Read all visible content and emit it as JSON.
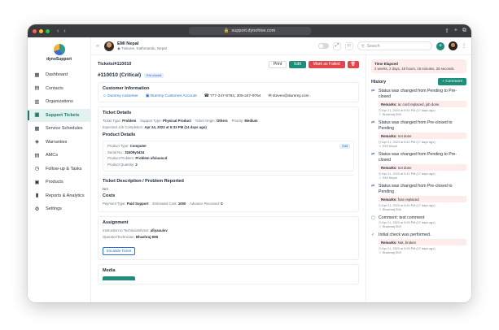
{
  "browser": {
    "url": "support.dynohive.com"
  },
  "brand": {
    "name": "dynoSupport"
  },
  "sidebar": {
    "items": [
      {
        "label": "Dashboard",
        "icon": "grid-icon"
      },
      {
        "label": "Contacts",
        "icon": "contacts-icon"
      },
      {
        "label": "Organizations",
        "icon": "building-icon"
      },
      {
        "label": "Support Tickets",
        "icon": "ticket-icon",
        "active": true
      },
      {
        "label": "Service Schedules",
        "icon": "calendar-icon"
      },
      {
        "label": "Warranties",
        "icon": "shield-icon"
      },
      {
        "label": "AMCs",
        "icon": "document-icon"
      },
      {
        "label": "Follow-up & Tasks",
        "icon": "clock-icon"
      },
      {
        "label": "Products",
        "icon": "box-icon"
      },
      {
        "label": "Reports & Analytics",
        "icon": "chart-icon"
      },
      {
        "label": "Settings",
        "icon": "gear-icon"
      }
    ]
  },
  "topbar": {
    "user_name": "EMI Nepal",
    "user_location": "Tinkune, Kathmandu, Nepal",
    "search_placeholder": "Search"
  },
  "ticket": {
    "breadcrumb": "Tickets/#110010",
    "title": "#110010 (Critical)",
    "priority_badge": "Pre-closed",
    "buttons": {
      "print": "Print",
      "edit": "Edit",
      "mark_failed": "Mark as Failed"
    },
    "customer": {
      "heading": "Customer Information",
      "name": "Dummy customer",
      "account": "Dummy Customer Account",
      "phone": "777-247-9764, 305-247-9764",
      "email": "steven@dummy.com"
    },
    "details": {
      "heading": "Ticket Details",
      "type_label": "Ticket Type:",
      "type": "Problem",
      "support_label": "Support Type:",
      "support": "Physical Product",
      "origin_label": "Ticket Origin:",
      "origin": "Others",
      "priority_label": "Priority:",
      "priority": "Medium",
      "completion_label": "Expected Job Completion:",
      "completion": "Apr 24, 2023 at 5:33 PM (14 days ago)"
    },
    "product": {
      "heading": "Product Details",
      "edit_chip": "Edit",
      "type_label": "Product Type:",
      "type": "Computer",
      "serial_label": "Serial No.:",
      "serial": "32409y0434",
      "problem_label": "Product Problem:",
      "problem": "Problem ufsiuuocd",
      "qty_label": "Product Quantity:",
      "qty": "2"
    },
    "description": {
      "heading": "Ticket Description / Problem Reported",
      "value": "N/A"
    },
    "costs": {
      "heading": "Costs",
      "payment_label": "Payment Type:",
      "payment": "Paid Support",
      "estimate_label": "Estimated Cost:",
      "estimate": "1000",
      "advance_label": "Advance Received:",
      "advance": "0"
    },
    "assignment": {
      "heading": "Assignment",
      "instruction_label": "Instruction to Technician/User:",
      "instruction": "afiyauuivv",
      "operator_label": "Operator/Technician:",
      "operator": "Bhashraj EMI",
      "escalate": "Escalate Ticket"
    },
    "media": {
      "heading": "Media"
    }
  },
  "history": {
    "elapsed_label": "Time Elapsed",
    "elapsed_value": "2 weeks, 2 days, 18 hours, 15 minutes, 26 seconds",
    "title": "History",
    "comment_button": "+ Comment",
    "entries": [
      {
        "text": "Status was changed from Pending to Pre-closed",
        "remarks_label": "Remarks:",
        "remarks": "ac cord replaced, job done",
        "date": "Apr 21, 2023 at 5:42 PM (17 days ago)",
        "by": "Bhashraj EMI"
      },
      {
        "text": "Status was changed from Pre-closed to Pending",
        "remarks_label": "Remarks:",
        "remarks": "not done",
        "date": "Apr 21, 2023 at 5:42 PM (17 days ago)",
        "by": "EMI Nepal"
      },
      {
        "text": "Status was changed from Pending to Pre-closed",
        "remarks_label": "Remarks:",
        "remarks": "not done",
        "date": "Apr 21, 2023 at 5:41 PM (17 days ago)",
        "by": "EMI Nepal"
      },
      {
        "text": "Status was changed from Pre-closed to Pending",
        "remarks_label": "Remarks:",
        "remarks": "fuse replaced",
        "date": "Apr 21, 2023 at 5:40 PM (17 days ago)",
        "by": "Bhashraj EMI"
      },
      {
        "text": "Comment: test comment",
        "date": "Apr 21, 2023 at 5:39 PM (17 days ago)",
        "by": "Bhashraj EMI"
      },
      {
        "text": "Initial check was performed.",
        "remarks_label": "Remarks:",
        "remarks": "Not, broken",
        "date": "Apr 21, 2023 at 5:39 PM (17 days ago)",
        "by": "Bhashraj EMI"
      }
    ]
  }
}
